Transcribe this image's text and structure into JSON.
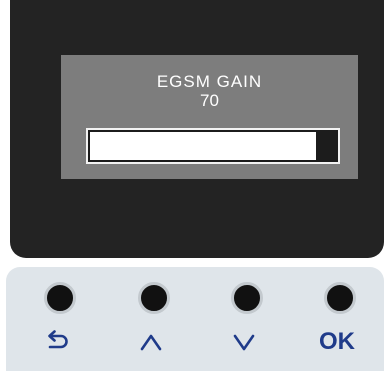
{
  "menu": {
    "title": "EGSM GAIN",
    "value": "70",
    "level_percent": 92
  },
  "buttons": {
    "back": {
      "icon": "return-arrow-icon"
    },
    "up": {
      "icon": "chevron-up-icon"
    },
    "down": {
      "icon": "chevron-down-icon"
    },
    "ok": {
      "label": "OK"
    }
  },
  "colors": {
    "screen_bezel": "#232323",
    "lcd_background": "#7d7d7d",
    "button_strip": "#dfe5ea",
    "label_blue": "#1f3b8a"
  }
}
